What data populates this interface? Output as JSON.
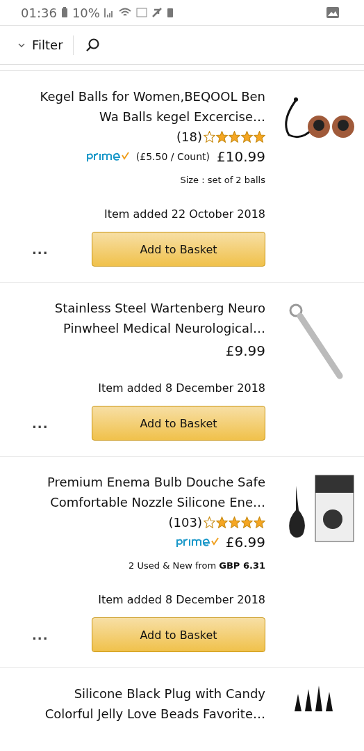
{
  "status_bar": {
    "time": "01:36",
    "battery": "10%"
  },
  "toolbar": {
    "filter": "Filter"
  },
  "items": [
    {
      "title": "Kegel Balls for Women,BEQOOL Ben Wa Balls kegel Excercise…",
      "stars": 4,
      "reviews": "(18)",
      "price": "£10.99",
      "unit_price": "(£5.50 / Count)",
      "prime": true,
      "detail": "Size : set of 2 balls",
      "added": "Item added 22 October 2018",
      "button": "Add to Basket",
      "more": "..."
    },
    {
      "title": "Stainless Steel Wartenberg Neuro Pinwheel Medical Neurological…",
      "price": "£9.99",
      "prime": false,
      "added": "Item added 8 December 2018",
      "button": "Add to Basket",
      "more": "..."
    },
    {
      "title": "Premium Enema Bulb Douche Safe Comfortable Nozzle Silicone Ene…",
      "stars": 4,
      "reviews": "(103)",
      "price": "£6.99",
      "prime": true,
      "detail": "2 Used & New from **GBP 6.31**",
      "added": "Item added 8 December 2018",
      "button": "Add to Basket",
      "more": "..."
    },
    {
      "title": "Silicone Black Plug with Candy Colorful Jelly Love Beads Favorite…"
    }
  ]
}
